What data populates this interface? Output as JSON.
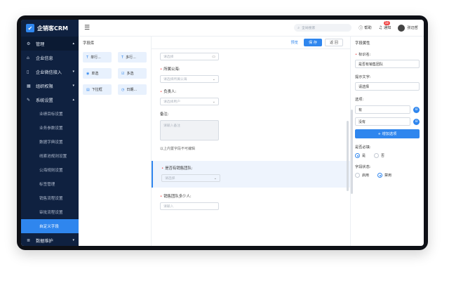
{
  "app": {
    "name": "企销客CRM"
  },
  "sidebar": {
    "top": {
      "label": "管理"
    },
    "groups": [
      {
        "label": "企业信息"
      },
      {
        "label": "企业微信接入"
      },
      {
        "label": "组织权限"
      },
      {
        "label": "系统设置"
      }
    ],
    "subitems": [
      {
        "label": "业绩目标设置"
      },
      {
        "label": "业务参数设置"
      },
      {
        "label": "数据字典设置"
      },
      {
        "label": "线索池规则设置"
      },
      {
        "label": "公海规则设置"
      },
      {
        "label": "标签管理"
      },
      {
        "label": "销售流程设置"
      },
      {
        "label": "审批流程设置"
      },
      {
        "label": "自定义字段"
      }
    ],
    "bottom": {
      "label": "数据维护"
    }
  },
  "topbar": {
    "search_placeholder": "全局搜索",
    "help": "帮助",
    "notify": "通知",
    "notify_count": "18",
    "user": "张迈哲"
  },
  "library": {
    "title": "字段库",
    "items": [
      {
        "label": "单行..."
      },
      {
        "label": "多行..."
      },
      {
        "label": "单选"
      },
      {
        "label": "多选"
      },
      {
        "label": "下拉框"
      },
      {
        "label": "日期..."
      }
    ]
  },
  "canvas": {
    "preview": "预览",
    "save": "保 存",
    "back": "返 回",
    "first_input_placeholder": "请选择",
    "fields": [
      {
        "label": "所属公海:",
        "placeholder": "请选择所属公海"
      },
      {
        "label": "负责人:",
        "placeholder": "请选择用户"
      }
    ],
    "remark_label": "备注:",
    "remark_placeholder": "请输入备注",
    "note": "以上内置字段不可编辑",
    "selected": {
      "label": "是否有销售团队:",
      "placeholder": "请选择"
    },
    "last": {
      "label": "销售团队多少人:",
      "placeholder": "请输入"
    }
  },
  "props": {
    "title": "字段属性",
    "name_label": "标识名:",
    "name_value": "是否有销售团队",
    "hint_label": "提示文字:",
    "hint_value": "请选择",
    "options_label": "选项:",
    "options": [
      {
        "value": "有"
      },
      {
        "value": "没有"
      }
    ],
    "add_option": "+ 增加选项",
    "required_label": "是否必填:",
    "required_yes": "是",
    "required_no": "否",
    "status_label": "字段状态:",
    "status_on": "启用",
    "status_off": "禁用"
  },
  "colors": {
    "accent": "#2f86ee",
    "sidebar": "#0f2140",
    "danger": "#f04848"
  }
}
